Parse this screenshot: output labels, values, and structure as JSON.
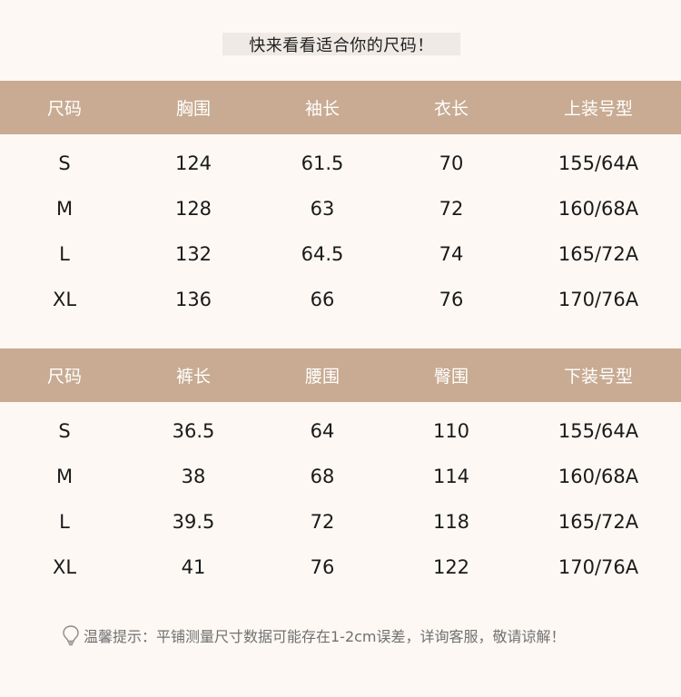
{
  "heading": "快来看看适合你的尺码！",
  "top_table": {
    "headers": [
      "尺码",
      "胸围",
      "袖长",
      "衣长",
      "上装号型"
    ],
    "rows": [
      [
        "S",
        "124",
        "61.5",
        "70",
        "155/64A"
      ],
      [
        "M",
        "128",
        "63",
        "72",
        "160/68A"
      ],
      [
        "L",
        "132",
        "64.5",
        "74",
        "165/72A"
      ],
      [
        "XL",
        "136",
        "66",
        "76",
        "170/76A"
      ]
    ]
  },
  "bottom_table": {
    "headers": [
      "尺码",
      "裤长",
      "腰围",
      "臀围",
      "下装号型"
    ],
    "rows": [
      [
        "S",
        "36.5",
        "64",
        "110",
        "155/64A"
      ],
      [
        "M",
        "38",
        "68",
        "114",
        "160/68A"
      ],
      [
        "L",
        "39.5",
        "72",
        "118",
        "165/72A"
      ],
      [
        "XL",
        "41",
        "76",
        "122",
        "170/76A"
      ]
    ]
  },
  "tip": {
    "icon": "lightbulb-icon",
    "text": "温馨提示：平铺测量尺寸数据可能存在1-2cm误差，详询客服，敬请谅解！"
  },
  "colors": {
    "background": "#fdf8f4",
    "header_band": "#c8ab92",
    "heading_box": "#efeae6"
  }
}
